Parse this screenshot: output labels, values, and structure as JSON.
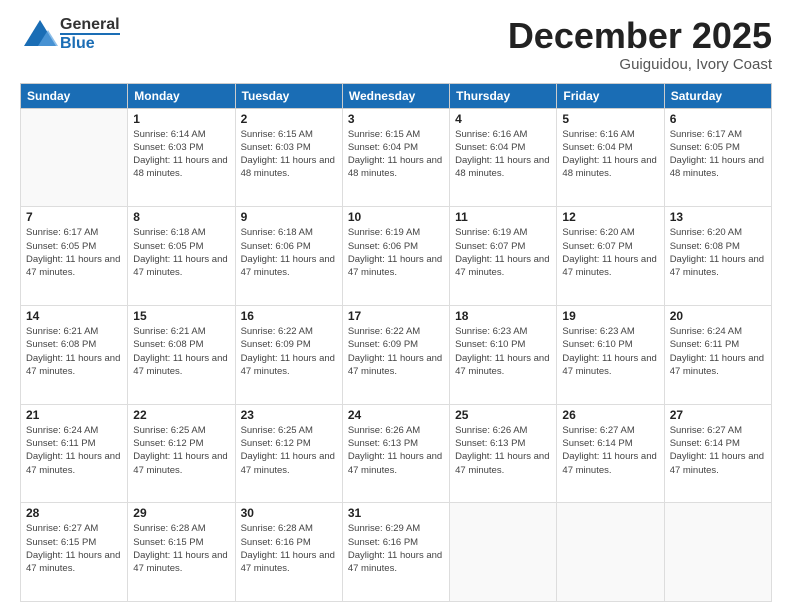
{
  "header": {
    "logo_general": "General",
    "logo_blue": "Blue",
    "month_title": "December 2025",
    "location": "Guiguidou, Ivory Coast"
  },
  "calendar": {
    "days_of_week": [
      "Sunday",
      "Monday",
      "Tuesday",
      "Wednesday",
      "Thursday",
      "Friday",
      "Saturday"
    ],
    "weeks": [
      [
        {
          "day": "",
          "sunrise": "",
          "sunset": "",
          "daylight": ""
        },
        {
          "day": "1",
          "sunrise": "Sunrise: 6:14 AM",
          "sunset": "Sunset: 6:03 PM",
          "daylight": "Daylight: 11 hours and 48 minutes."
        },
        {
          "day": "2",
          "sunrise": "Sunrise: 6:15 AM",
          "sunset": "Sunset: 6:03 PM",
          "daylight": "Daylight: 11 hours and 48 minutes."
        },
        {
          "day": "3",
          "sunrise": "Sunrise: 6:15 AM",
          "sunset": "Sunset: 6:04 PM",
          "daylight": "Daylight: 11 hours and 48 minutes."
        },
        {
          "day": "4",
          "sunrise": "Sunrise: 6:16 AM",
          "sunset": "Sunset: 6:04 PM",
          "daylight": "Daylight: 11 hours and 48 minutes."
        },
        {
          "day": "5",
          "sunrise": "Sunrise: 6:16 AM",
          "sunset": "Sunset: 6:04 PM",
          "daylight": "Daylight: 11 hours and 48 minutes."
        },
        {
          "day": "6",
          "sunrise": "Sunrise: 6:17 AM",
          "sunset": "Sunset: 6:05 PM",
          "daylight": "Daylight: 11 hours and 48 minutes."
        }
      ],
      [
        {
          "day": "7",
          "sunrise": "Sunrise: 6:17 AM",
          "sunset": "Sunset: 6:05 PM",
          "daylight": "Daylight: 11 hours and 47 minutes."
        },
        {
          "day": "8",
          "sunrise": "Sunrise: 6:18 AM",
          "sunset": "Sunset: 6:05 PM",
          "daylight": "Daylight: 11 hours and 47 minutes."
        },
        {
          "day": "9",
          "sunrise": "Sunrise: 6:18 AM",
          "sunset": "Sunset: 6:06 PM",
          "daylight": "Daylight: 11 hours and 47 minutes."
        },
        {
          "day": "10",
          "sunrise": "Sunrise: 6:19 AM",
          "sunset": "Sunset: 6:06 PM",
          "daylight": "Daylight: 11 hours and 47 minutes."
        },
        {
          "day": "11",
          "sunrise": "Sunrise: 6:19 AM",
          "sunset": "Sunset: 6:07 PM",
          "daylight": "Daylight: 11 hours and 47 minutes."
        },
        {
          "day": "12",
          "sunrise": "Sunrise: 6:20 AM",
          "sunset": "Sunset: 6:07 PM",
          "daylight": "Daylight: 11 hours and 47 minutes."
        },
        {
          "day": "13",
          "sunrise": "Sunrise: 6:20 AM",
          "sunset": "Sunset: 6:08 PM",
          "daylight": "Daylight: 11 hours and 47 minutes."
        }
      ],
      [
        {
          "day": "14",
          "sunrise": "Sunrise: 6:21 AM",
          "sunset": "Sunset: 6:08 PM",
          "daylight": "Daylight: 11 hours and 47 minutes."
        },
        {
          "day": "15",
          "sunrise": "Sunrise: 6:21 AM",
          "sunset": "Sunset: 6:08 PM",
          "daylight": "Daylight: 11 hours and 47 minutes."
        },
        {
          "day": "16",
          "sunrise": "Sunrise: 6:22 AM",
          "sunset": "Sunset: 6:09 PM",
          "daylight": "Daylight: 11 hours and 47 minutes."
        },
        {
          "day": "17",
          "sunrise": "Sunrise: 6:22 AM",
          "sunset": "Sunset: 6:09 PM",
          "daylight": "Daylight: 11 hours and 47 minutes."
        },
        {
          "day": "18",
          "sunrise": "Sunrise: 6:23 AM",
          "sunset": "Sunset: 6:10 PM",
          "daylight": "Daylight: 11 hours and 47 minutes."
        },
        {
          "day": "19",
          "sunrise": "Sunrise: 6:23 AM",
          "sunset": "Sunset: 6:10 PM",
          "daylight": "Daylight: 11 hours and 47 minutes."
        },
        {
          "day": "20",
          "sunrise": "Sunrise: 6:24 AM",
          "sunset": "Sunset: 6:11 PM",
          "daylight": "Daylight: 11 hours and 47 minutes."
        }
      ],
      [
        {
          "day": "21",
          "sunrise": "Sunrise: 6:24 AM",
          "sunset": "Sunset: 6:11 PM",
          "daylight": "Daylight: 11 hours and 47 minutes."
        },
        {
          "day": "22",
          "sunrise": "Sunrise: 6:25 AM",
          "sunset": "Sunset: 6:12 PM",
          "daylight": "Daylight: 11 hours and 47 minutes."
        },
        {
          "day": "23",
          "sunrise": "Sunrise: 6:25 AM",
          "sunset": "Sunset: 6:12 PM",
          "daylight": "Daylight: 11 hours and 47 minutes."
        },
        {
          "day": "24",
          "sunrise": "Sunrise: 6:26 AM",
          "sunset": "Sunset: 6:13 PM",
          "daylight": "Daylight: 11 hours and 47 minutes."
        },
        {
          "day": "25",
          "sunrise": "Sunrise: 6:26 AM",
          "sunset": "Sunset: 6:13 PM",
          "daylight": "Daylight: 11 hours and 47 minutes."
        },
        {
          "day": "26",
          "sunrise": "Sunrise: 6:27 AM",
          "sunset": "Sunset: 6:14 PM",
          "daylight": "Daylight: 11 hours and 47 minutes."
        },
        {
          "day": "27",
          "sunrise": "Sunrise: 6:27 AM",
          "sunset": "Sunset: 6:14 PM",
          "daylight": "Daylight: 11 hours and 47 minutes."
        }
      ],
      [
        {
          "day": "28",
          "sunrise": "Sunrise: 6:27 AM",
          "sunset": "Sunset: 6:15 PM",
          "daylight": "Daylight: 11 hours and 47 minutes."
        },
        {
          "day": "29",
          "sunrise": "Sunrise: 6:28 AM",
          "sunset": "Sunset: 6:15 PM",
          "daylight": "Daylight: 11 hours and 47 minutes."
        },
        {
          "day": "30",
          "sunrise": "Sunrise: 6:28 AM",
          "sunset": "Sunset: 6:16 PM",
          "daylight": "Daylight: 11 hours and 47 minutes."
        },
        {
          "day": "31",
          "sunrise": "Sunrise: 6:29 AM",
          "sunset": "Sunset: 6:16 PM",
          "daylight": "Daylight: 11 hours and 47 minutes."
        },
        {
          "day": "",
          "sunrise": "",
          "sunset": "",
          "daylight": ""
        },
        {
          "day": "",
          "sunrise": "",
          "sunset": "",
          "daylight": ""
        },
        {
          "day": "",
          "sunrise": "",
          "sunset": "",
          "daylight": ""
        }
      ]
    ]
  }
}
